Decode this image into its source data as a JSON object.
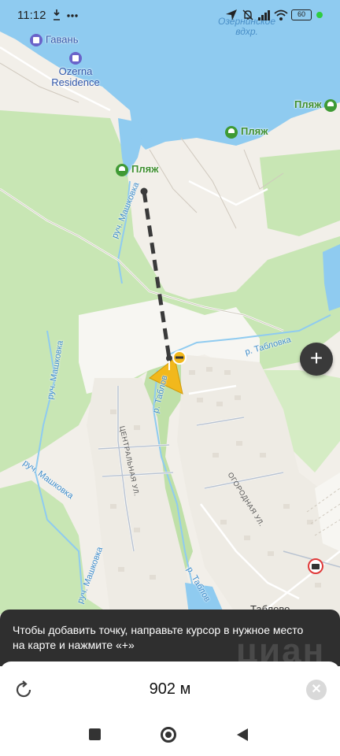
{
  "status_bar": {
    "time": "11:12",
    "battery": "60"
  },
  "map": {
    "labels": {
      "reservoir": "Озернинское\nвдхр.",
      "gavan": "Гавань",
      "ozerna": "Ozerna\nResidence",
      "beach_right": "Пляж",
      "beach_center": "Пляж",
      "beach_left": "Пляж",
      "stream_mashkovka_1": "руч. Машковка",
      "stream_mashkovka_2": "руч. Машковка",
      "stream_mashkovka_3": "руч. Машковка",
      "stream_mashkovka_4": "руч. Машковка",
      "river_tablovka_1": "р. Табловка",
      "river_tablovka_2": "р. Таблов",
      "river_tablovka_3": "р. Таблов",
      "street_central": "ЦЕНТРАЛЬНАЯ УЛ.",
      "street_ogorodnaya": "ОГОРОДНАЯ УЛ.",
      "village": "Таблово"
    },
    "colors": {
      "water": "#8fcbf0",
      "forest": "#c8e6b4",
      "land": "#f2efe9",
      "route": "#3a3a3a",
      "marker": "#f2b81c"
    }
  },
  "controls": {
    "zoom_in_label": "+"
  },
  "hint": {
    "text": "Чтобы добавить точку, направьте курсор в нужное место на карте и нажмите «+»",
    "watermark": "циан"
  },
  "ruler": {
    "distance": "902 м",
    "undo_icon": "rotate-icon",
    "clear_icon": "close-icon"
  }
}
